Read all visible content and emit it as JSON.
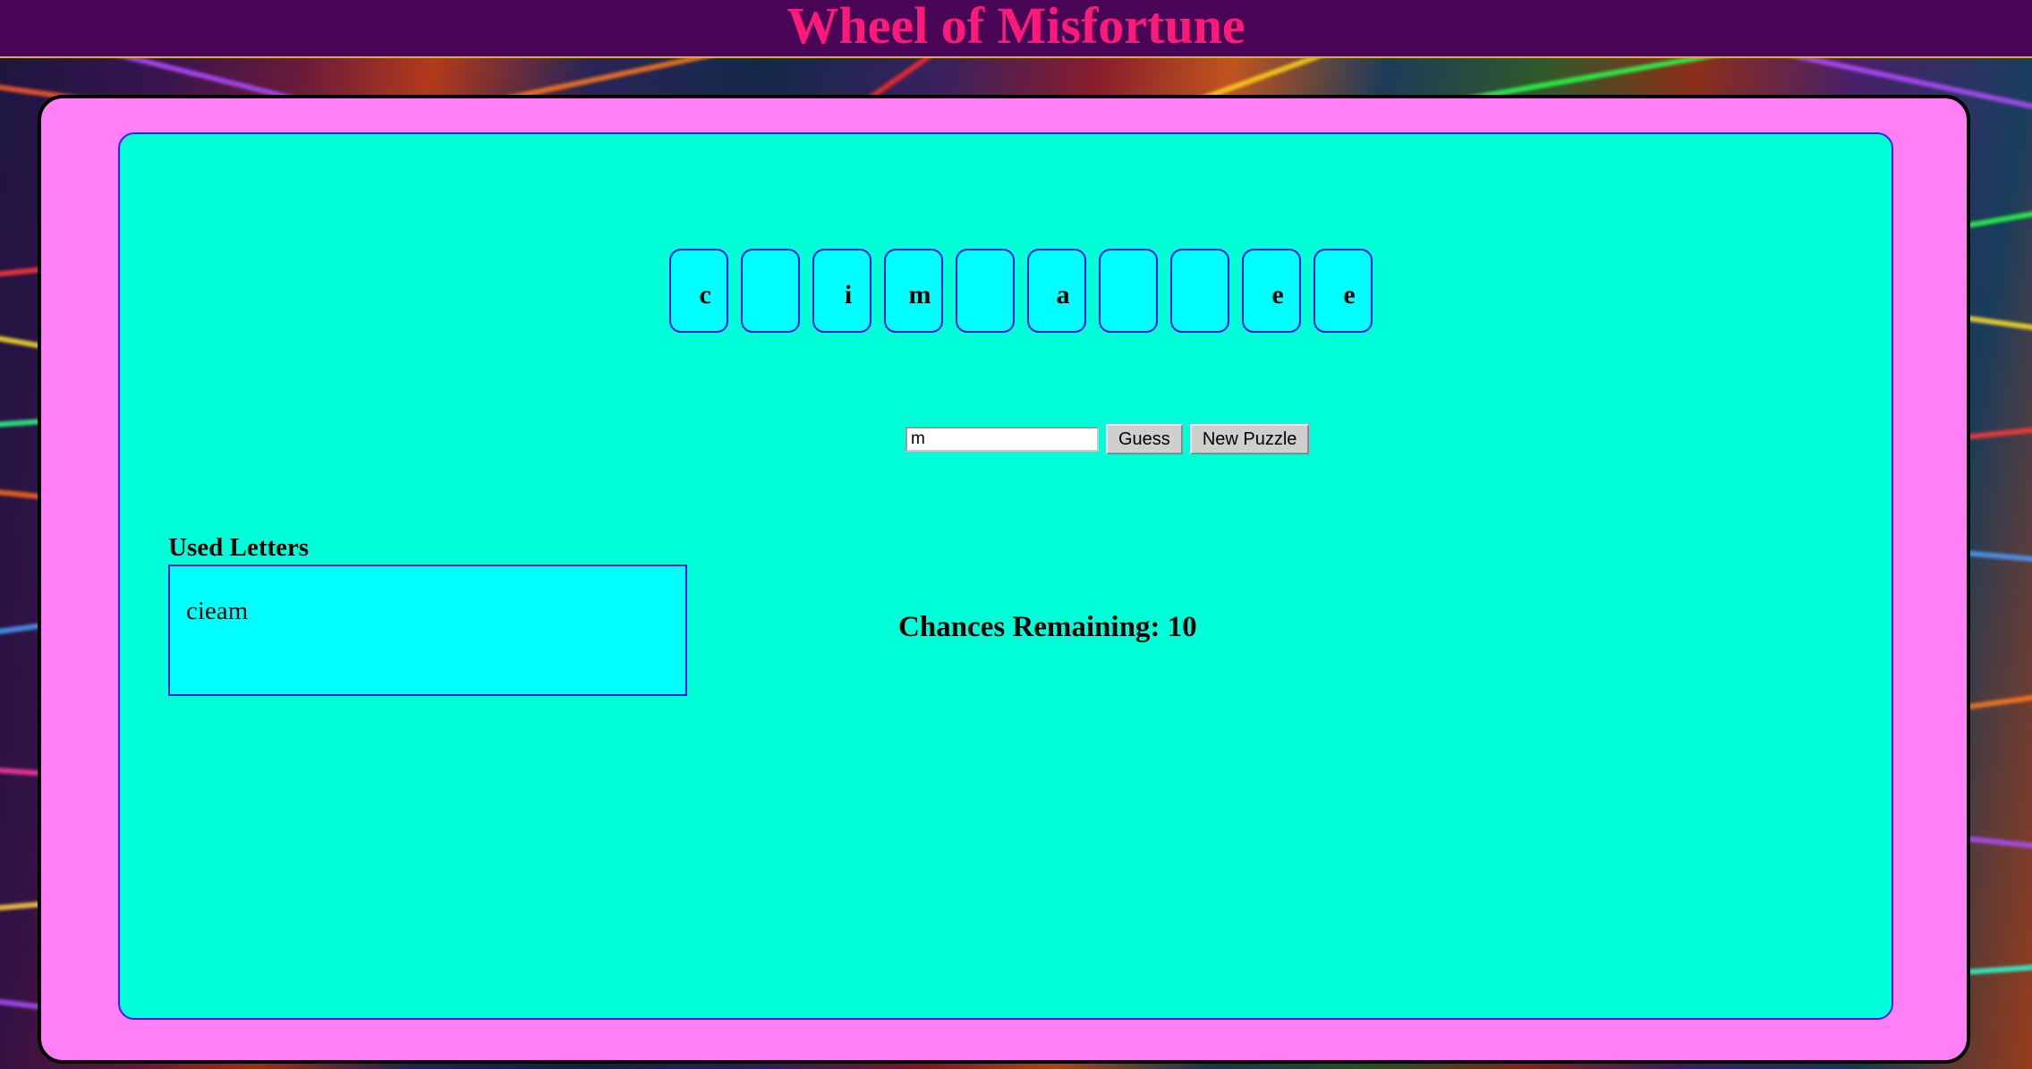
{
  "header": {
    "title": "Wheel of Misfortune"
  },
  "puzzle": {
    "tiles": [
      "c",
      "",
      "i",
      "m",
      "",
      "a",
      "",
      "",
      "e",
      "e"
    ]
  },
  "guess": {
    "input_value": "m",
    "guess_label": "Guess",
    "new_puzzle_label": "New Puzzle"
  },
  "used_letters": {
    "heading": "Used Letters",
    "letters": "cieam"
  },
  "status": {
    "chances_label": "Chances Remaining: 10"
  },
  "colors": {
    "header_bg": "#4a0656",
    "title": "#ff1a7a",
    "outer_frame": "#ff80f6",
    "inner_panel": "#00ffd8",
    "tile_bg": "#00ffff",
    "tile_border": "#2a18e8"
  }
}
